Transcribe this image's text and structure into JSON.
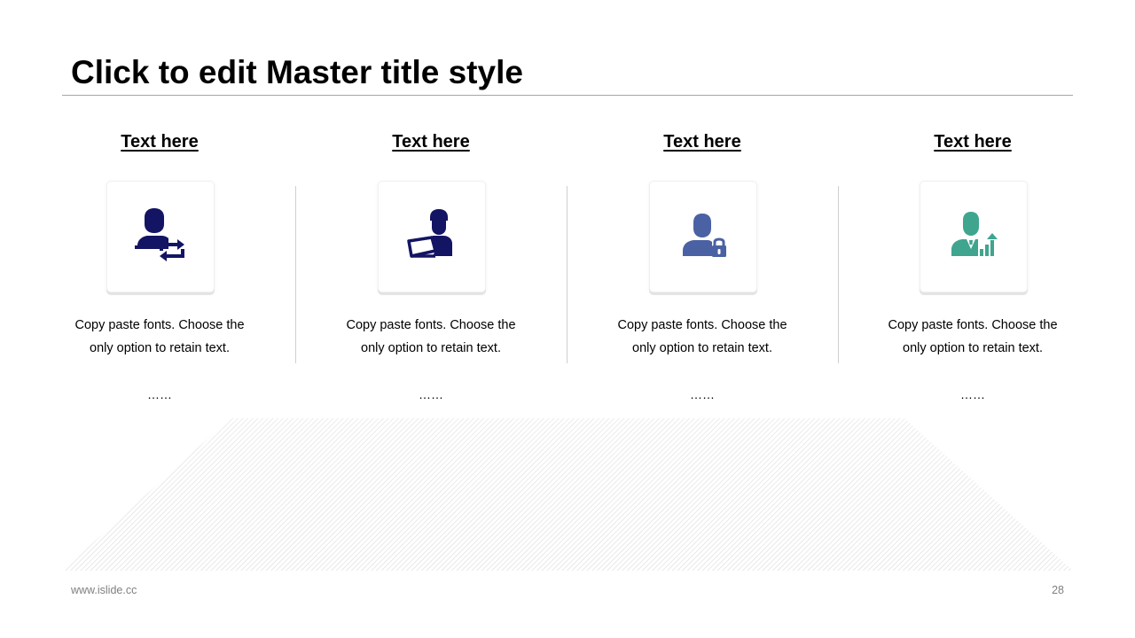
{
  "slide": {
    "title": "Click to edit Master title style",
    "footer_url": "www.islide.cc",
    "page_number": "28"
  },
  "columns": [
    {
      "heading": "Text here",
      "body_line1": "Copy paste fonts. Choose the",
      "body_line2": "only option to retain text.",
      "dots": "……",
      "icon": "user-sync-icon",
      "icon_color": "#141464"
    },
    {
      "heading": "Text here",
      "body_line1": "Copy paste fonts. Choose the",
      "body_line2": "only option to retain text.",
      "dots": "……",
      "icon": "user-laptop-icon",
      "icon_color": "#141464"
    },
    {
      "heading": "Text here",
      "body_line1": "Copy paste fonts. Choose the",
      "body_line2": "only option to retain text.",
      "dots": "……",
      "icon": "user-lock-icon",
      "icon_color": "#4a62a3"
    },
    {
      "heading": "Text here",
      "body_line1": "Copy paste fonts. Choose the",
      "body_line2": "only option to retain text.",
      "dots": "……",
      "icon": "user-growth-icon",
      "icon_color": "#3fa58f"
    }
  ]
}
